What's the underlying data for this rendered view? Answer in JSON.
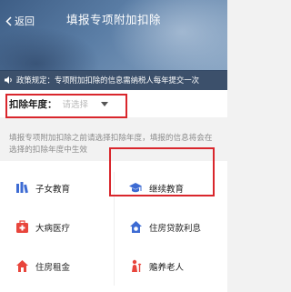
{
  "header": {
    "back_label": "返回",
    "title": "填报专项附加扣除"
  },
  "notice": {
    "text": "政策规定：专项附加扣除的信息需纳税人每年提交一次"
  },
  "year": {
    "label": "扣除年度：",
    "placeholder": "请选择"
  },
  "hint": "填报专项附加扣除之前请选择扣除年度，填报的信息将会在选择的扣除年度中生效",
  "items": [
    {
      "label": "子女教育",
      "icon": "children-education-icon"
    },
    {
      "label": "继续教育",
      "icon": "graduation-cap-icon"
    },
    {
      "label": "大病医疗",
      "icon": "medical-kit-icon"
    },
    {
      "label": "住房贷款利息",
      "icon": "house-loan-icon"
    },
    {
      "label": "住房租金",
      "icon": "house-rent-icon"
    },
    {
      "label": "赡养老人",
      "icon": "elderly-care-icon"
    }
  ],
  "colors": {
    "accent_blue": "#3d6bd3",
    "accent_red": "#e8453c",
    "highlight_box": "#d9262c"
  }
}
